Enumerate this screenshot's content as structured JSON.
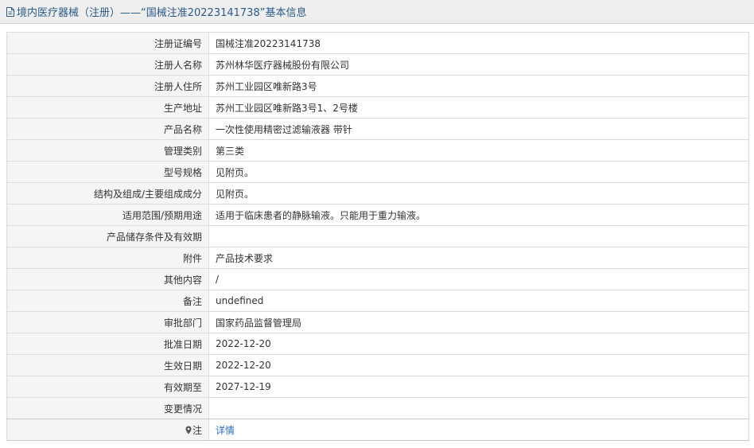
{
  "header": {
    "title": "境内医疗器械（注册）——“国械注准20223141738”基本信息",
    "icon": "document-icon"
  },
  "rows": [
    {
      "label": "注册证编号",
      "value": "国械注准20223141738"
    },
    {
      "label": "注册人名称",
      "value": "苏州林华医疗器械股份有限公司"
    },
    {
      "label": "注册人住所",
      "value": "苏州工业园区唯新路3号"
    },
    {
      "label": "生产地址",
      "value": "苏州工业园区唯新路3号1、2号楼"
    },
    {
      "label": "产品名称",
      "value": "一次性使用精密过滤输液器 带针"
    },
    {
      "label": "管理类别",
      "value": "第三类"
    },
    {
      "label": "型号规格",
      "value": "见附页。"
    },
    {
      "label": "结构及组成/主要组成成分",
      "value": "见附页。"
    },
    {
      "label": "适用范围/预期用途",
      "value": "适用于临床患者的静脉输液。只能用于重力输液。"
    },
    {
      "label": "产品储存条件及有效期",
      "value": ""
    },
    {
      "label": "附件",
      "value": "产品技术要求"
    },
    {
      "label": "其他内容",
      "value": "/"
    },
    {
      "label": "备注",
      "value": "undefined"
    },
    {
      "label": "审批部门",
      "value": "国家药品监督管理局"
    },
    {
      "label": "批准日期",
      "value": "2022-12-20"
    },
    {
      "label": "生效日期",
      "value": "2022-12-20"
    },
    {
      "label": "有效期至",
      "value": "2027-12-19"
    },
    {
      "label": "变更情况",
      "value": ""
    }
  ],
  "note_row": {
    "label": "注",
    "icon": "map-pin-icon",
    "link": "详情"
  },
  "colors": {
    "header_bg": "#eeeeee",
    "header_text": "#2b5a8a",
    "label_bg": "#f5f5f5",
    "border": "#dcdcdc",
    "link": "#2a6fc9"
  }
}
